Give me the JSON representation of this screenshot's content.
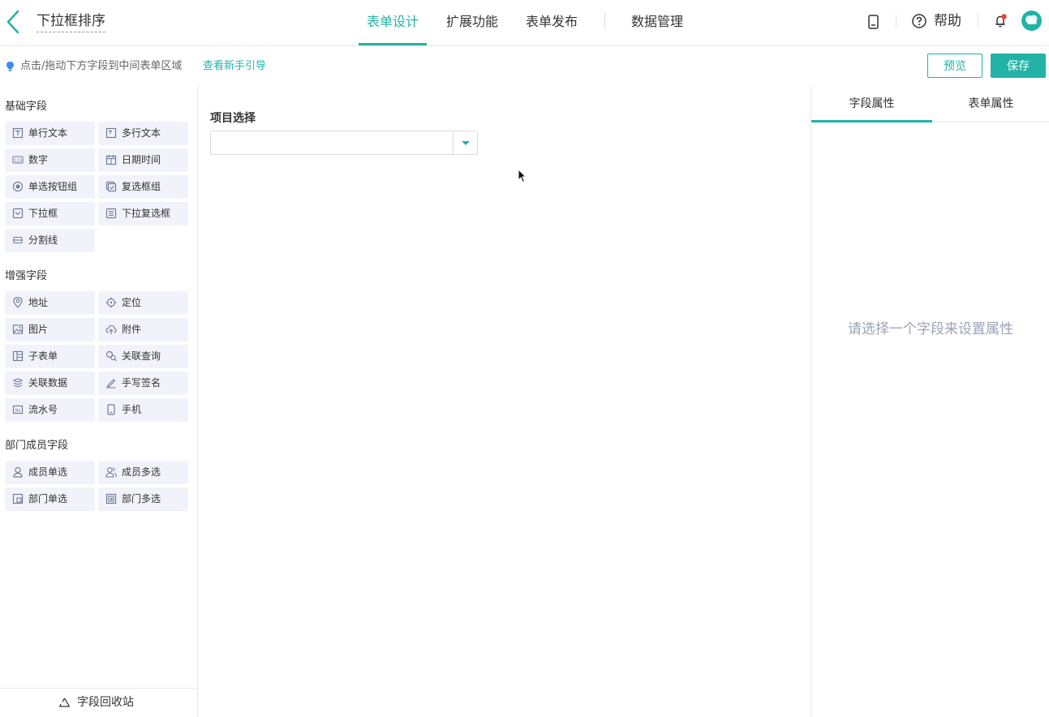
{
  "header": {
    "form_title": "下拉框排序",
    "tabs": [
      {
        "label": "表单设计",
        "active": true
      },
      {
        "label": "扩展功能",
        "active": false
      },
      {
        "label": "表单发布",
        "active": false
      },
      {
        "label": "数据管理",
        "active": false
      }
    ],
    "help_label": "帮助",
    "accent_color": "#23b3a6",
    "notification_dot_color": "#e8443b"
  },
  "subbar": {
    "tip_text": "点击/拖动下方字段到中间表单区域",
    "guide_link": "查看新手引导",
    "preview_label": "预览",
    "save_label": "保存"
  },
  "left_panel": {
    "groups": [
      {
        "title": "基础字段",
        "items": [
          {
            "label": "单行文本",
            "icon": "text-line-icon"
          },
          {
            "label": "多行文本",
            "icon": "text-multiline-icon"
          },
          {
            "label": "数字",
            "icon": "number-icon"
          },
          {
            "label": "日期时间",
            "icon": "calendar-icon"
          },
          {
            "label": "单选按钮组",
            "icon": "radio-icon"
          },
          {
            "label": "复选框组",
            "icon": "checkbox-group-icon"
          },
          {
            "label": "下拉框",
            "icon": "dropdown-icon"
          },
          {
            "label": "下拉复选框",
            "icon": "dropdown-checkbox-icon"
          },
          {
            "label": "分割线",
            "icon": "divider-icon"
          }
        ]
      },
      {
        "title": "增强字段",
        "items": [
          {
            "label": "地址",
            "icon": "map-pin-icon"
          },
          {
            "label": "定位",
            "icon": "locate-icon"
          },
          {
            "label": "图片",
            "icon": "image-icon"
          },
          {
            "label": "附件",
            "icon": "upload-cloud-icon"
          },
          {
            "label": "子表单",
            "icon": "subform-icon"
          },
          {
            "label": "关联查询",
            "icon": "link-query-icon"
          },
          {
            "label": "关联数据",
            "icon": "link-data-icon"
          },
          {
            "label": "手写签名",
            "icon": "pen-icon"
          },
          {
            "label": "流水号",
            "icon": "serial-number-icon"
          },
          {
            "label": "手机",
            "icon": "mobile-icon"
          }
        ]
      },
      {
        "title": "部门成员字段",
        "items": [
          {
            "label": "成员单选",
            "icon": "user-icon"
          },
          {
            "label": "成员多选",
            "icon": "users-icon"
          },
          {
            "label": "部门单选",
            "icon": "department-icon"
          },
          {
            "label": "部门多选",
            "icon": "departments-icon"
          }
        ]
      }
    ],
    "recycle_label": "字段回收站"
  },
  "canvas": {
    "field_label": "项目选择",
    "field_value": ""
  },
  "right_panel": {
    "tabs": [
      {
        "label": "字段属性",
        "active": true
      },
      {
        "label": "表单属性",
        "active": false
      }
    ],
    "empty_hint": "请选择一个字段来设置属性"
  }
}
